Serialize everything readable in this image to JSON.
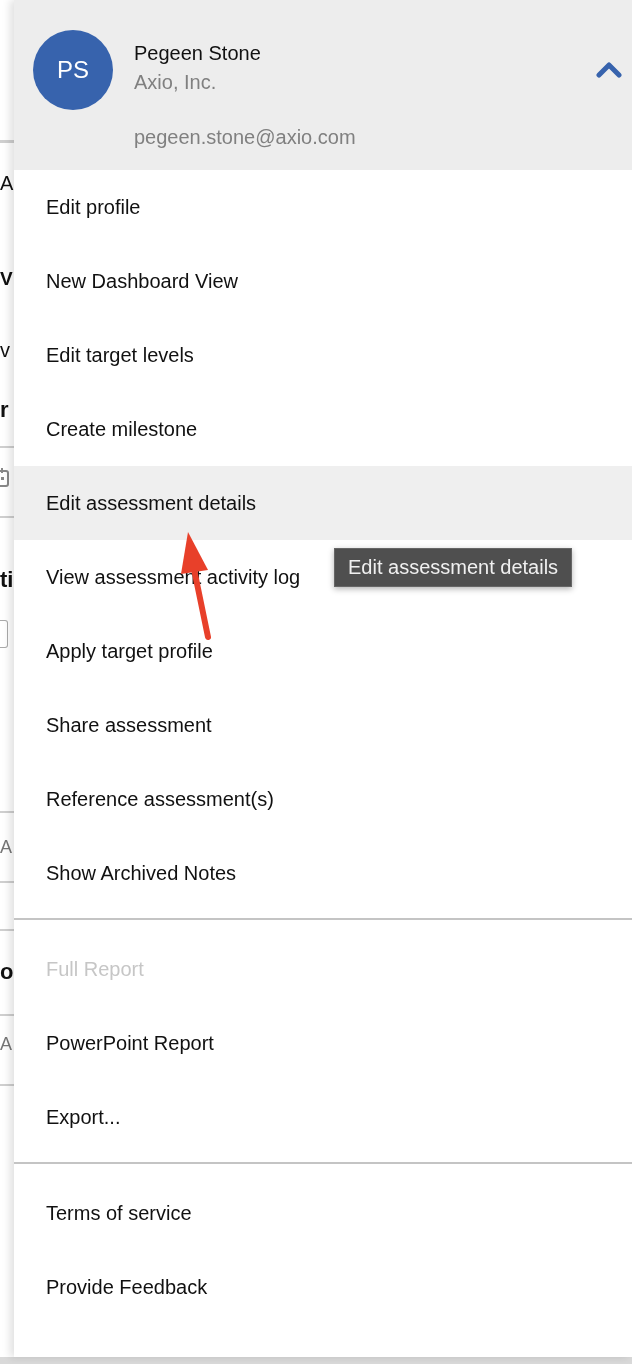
{
  "background_fragments": [
    {
      "text": "A",
      "kind": "plain"
    },
    {
      "text": "V",
      "kind": "title"
    },
    {
      "text": "v",
      "kind": "plain"
    },
    {
      "text": "r",
      "kind": "heading"
    },
    {
      "text": "ti",
      "kind": "heading"
    },
    {
      "text": "A",
      "kind": "muted"
    },
    {
      "text": "o",
      "kind": "heading"
    },
    {
      "text": "A",
      "kind": "muted"
    }
  ],
  "profile": {
    "initials": "PS",
    "name": "Pegeen Stone",
    "company": "Axio, Inc.",
    "email": "pegeen.stone@axio.com",
    "expanded": true
  },
  "menu_groups": [
    [
      {
        "label": "Edit profile",
        "selected": false,
        "disabled": false
      },
      {
        "label": "New Dashboard View",
        "selected": false,
        "disabled": false
      },
      {
        "label": "Edit target levels",
        "selected": false,
        "disabled": false
      },
      {
        "label": "Create milestone",
        "selected": false,
        "disabled": false
      },
      {
        "label": "Edit assessment details",
        "selected": true,
        "disabled": false
      },
      {
        "label": "View assessment activity log",
        "selected": false,
        "disabled": false
      },
      {
        "label": "Apply target profile",
        "selected": false,
        "disabled": false
      },
      {
        "label": "Share assessment",
        "selected": false,
        "disabled": false
      },
      {
        "label": "Reference assessment(s)",
        "selected": false,
        "disabled": false
      },
      {
        "label": "Show Archived Notes",
        "selected": false,
        "disabled": false
      }
    ],
    [
      {
        "label": "Full Report",
        "selected": false,
        "disabled": true
      },
      {
        "label": "PowerPoint Report",
        "selected": false,
        "disabled": false
      },
      {
        "label": "Export...",
        "selected": false,
        "disabled": false
      }
    ],
    [
      {
        "label": "Terms of service",
        "selected": false,
        "disabled": false
      },
      {
        "label": "Provide Feedback",
        "selected": false,
        "disabled": false
      }
    ]
  ],
  "tooltip": "Edit assessment details"
}
